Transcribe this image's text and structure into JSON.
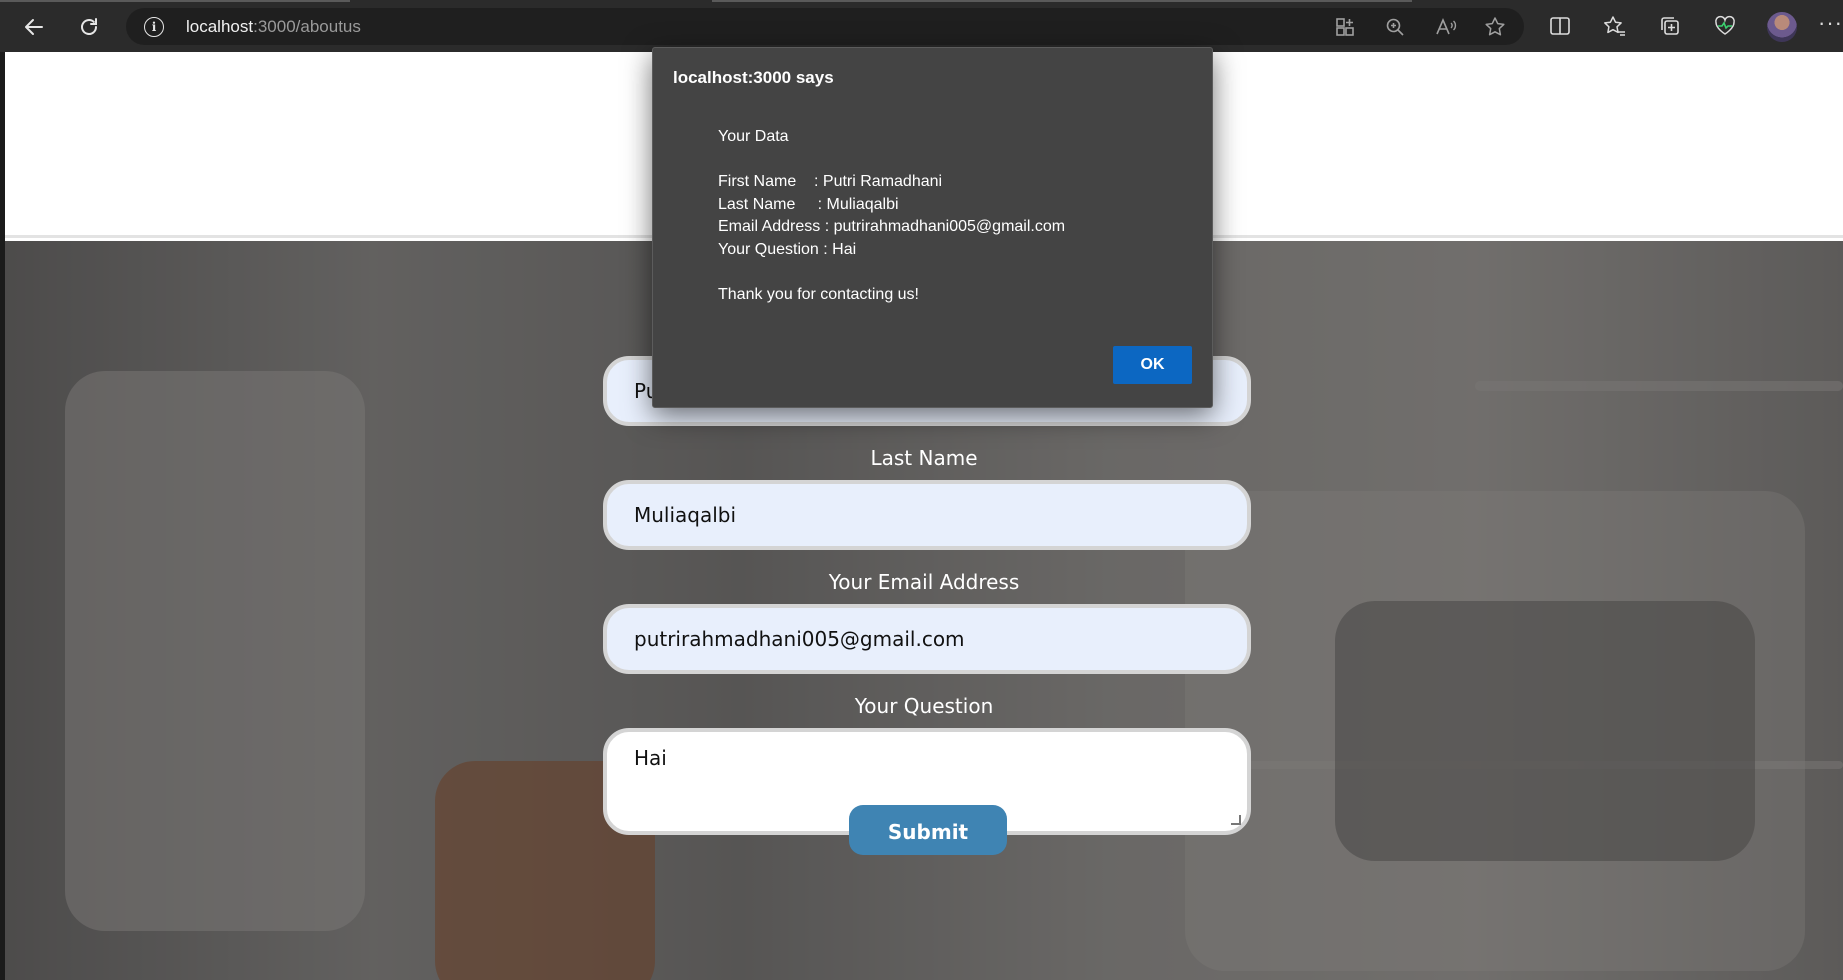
{
  "browser": {
    "url_host": "localhost",
    "url_rest": ":3000/aboutus"
  },
  "form": {
    "first_name_value_visible": "Pu",
    "last_name_label": "Last Name",
    "last_name_value": "Muliaqalbi",
    "email_label": "Your Email Address",
    "email_value": "putrirahmadhani005@gmail.com",
    "question_label": "Your Question",
    "question_value": "Hai",
    "submit_label": "Submit"
  },
  "dialog": {
    "title": "localhost:3000 says",
    "heading": "Your Data",
    "lines": [
      "First Name    : Putri Ramadhani",
      "Last Name     : Muliaqalbi",
      "Email Address : putrirahmadhani005@gmail.com",
      "Your Question : Hai"
    ],
    "closing": "Thank you for contacting us!",
    "ok_label": "OK"
  },
  "colors": {
    "dialog_bg": "#444444",
    "ok_button": "#0c67c2",
    "submit_button": "#3f84b3",
    "field_bg": "#e8effc"
  },
  "icons": [
    "back-icon",
    "refresh-icon",
    "info-icon",
    "apps-icon",
    "zoom-icon",
    "read-aloud-icon",
    "favorite-star-icon",
    "split-screen-icon",
    "favorites-icon",
    "collections-icon",
    "health-icon",
    "profile-avatar",
    "more-icon"
  ]
}
